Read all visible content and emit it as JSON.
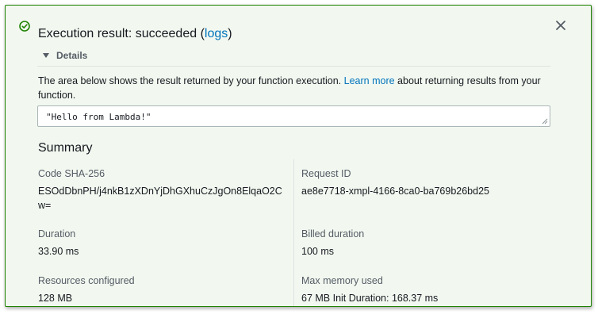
{
  "result": {
    "title_prefix": "Execution result: succeeded (",
    "logs_link": "logs",
    "title_suffix": ")",
    "details_label": "Details",
    "description_before": "The area below shows the result returned by your function execution. ",
    "learn_more": "Learn more",
    "description_after": " about returning results from your function.",
    "output": "\"Hello from Lambda!\""
  },
  "summary": {
    "title": "Summary",
    "code_sha_label": "Code SHA-256",
    "code_sha_line1": "ESOdDbnPH/j4nkB1zXDnYjDhGXhuCzJgOn8ElqaO2C",
    "code_sha_line2": "w=",
    "request_id_label": "Request ID",
    "request_id_value": "ae8e7718-xmpl-4166-8ca0-ba769b26bd25",
    "duration_label": "Duration",
    "duration_value": "33.90 ms",
    "billed_label": "Billed duration",
    "billed_value": "100 ms",
    "resources_label": "Resources configured",
    "resources_value": "128 MB",
    "max_memory_label": "Max memory used",
    "max_memory_value": "67 MB Init Duration: 168.37 ms"
  },
  "colors": {
    "success": "#1d8102",
    "link": "#0073bb",
    "panel_bg": "#f2f8f0"
  },
  "icons": {
    "status": "check-circle-icon",
    "close": "close-icon",
    "toggle": "caret-down-icon"
  }
}
